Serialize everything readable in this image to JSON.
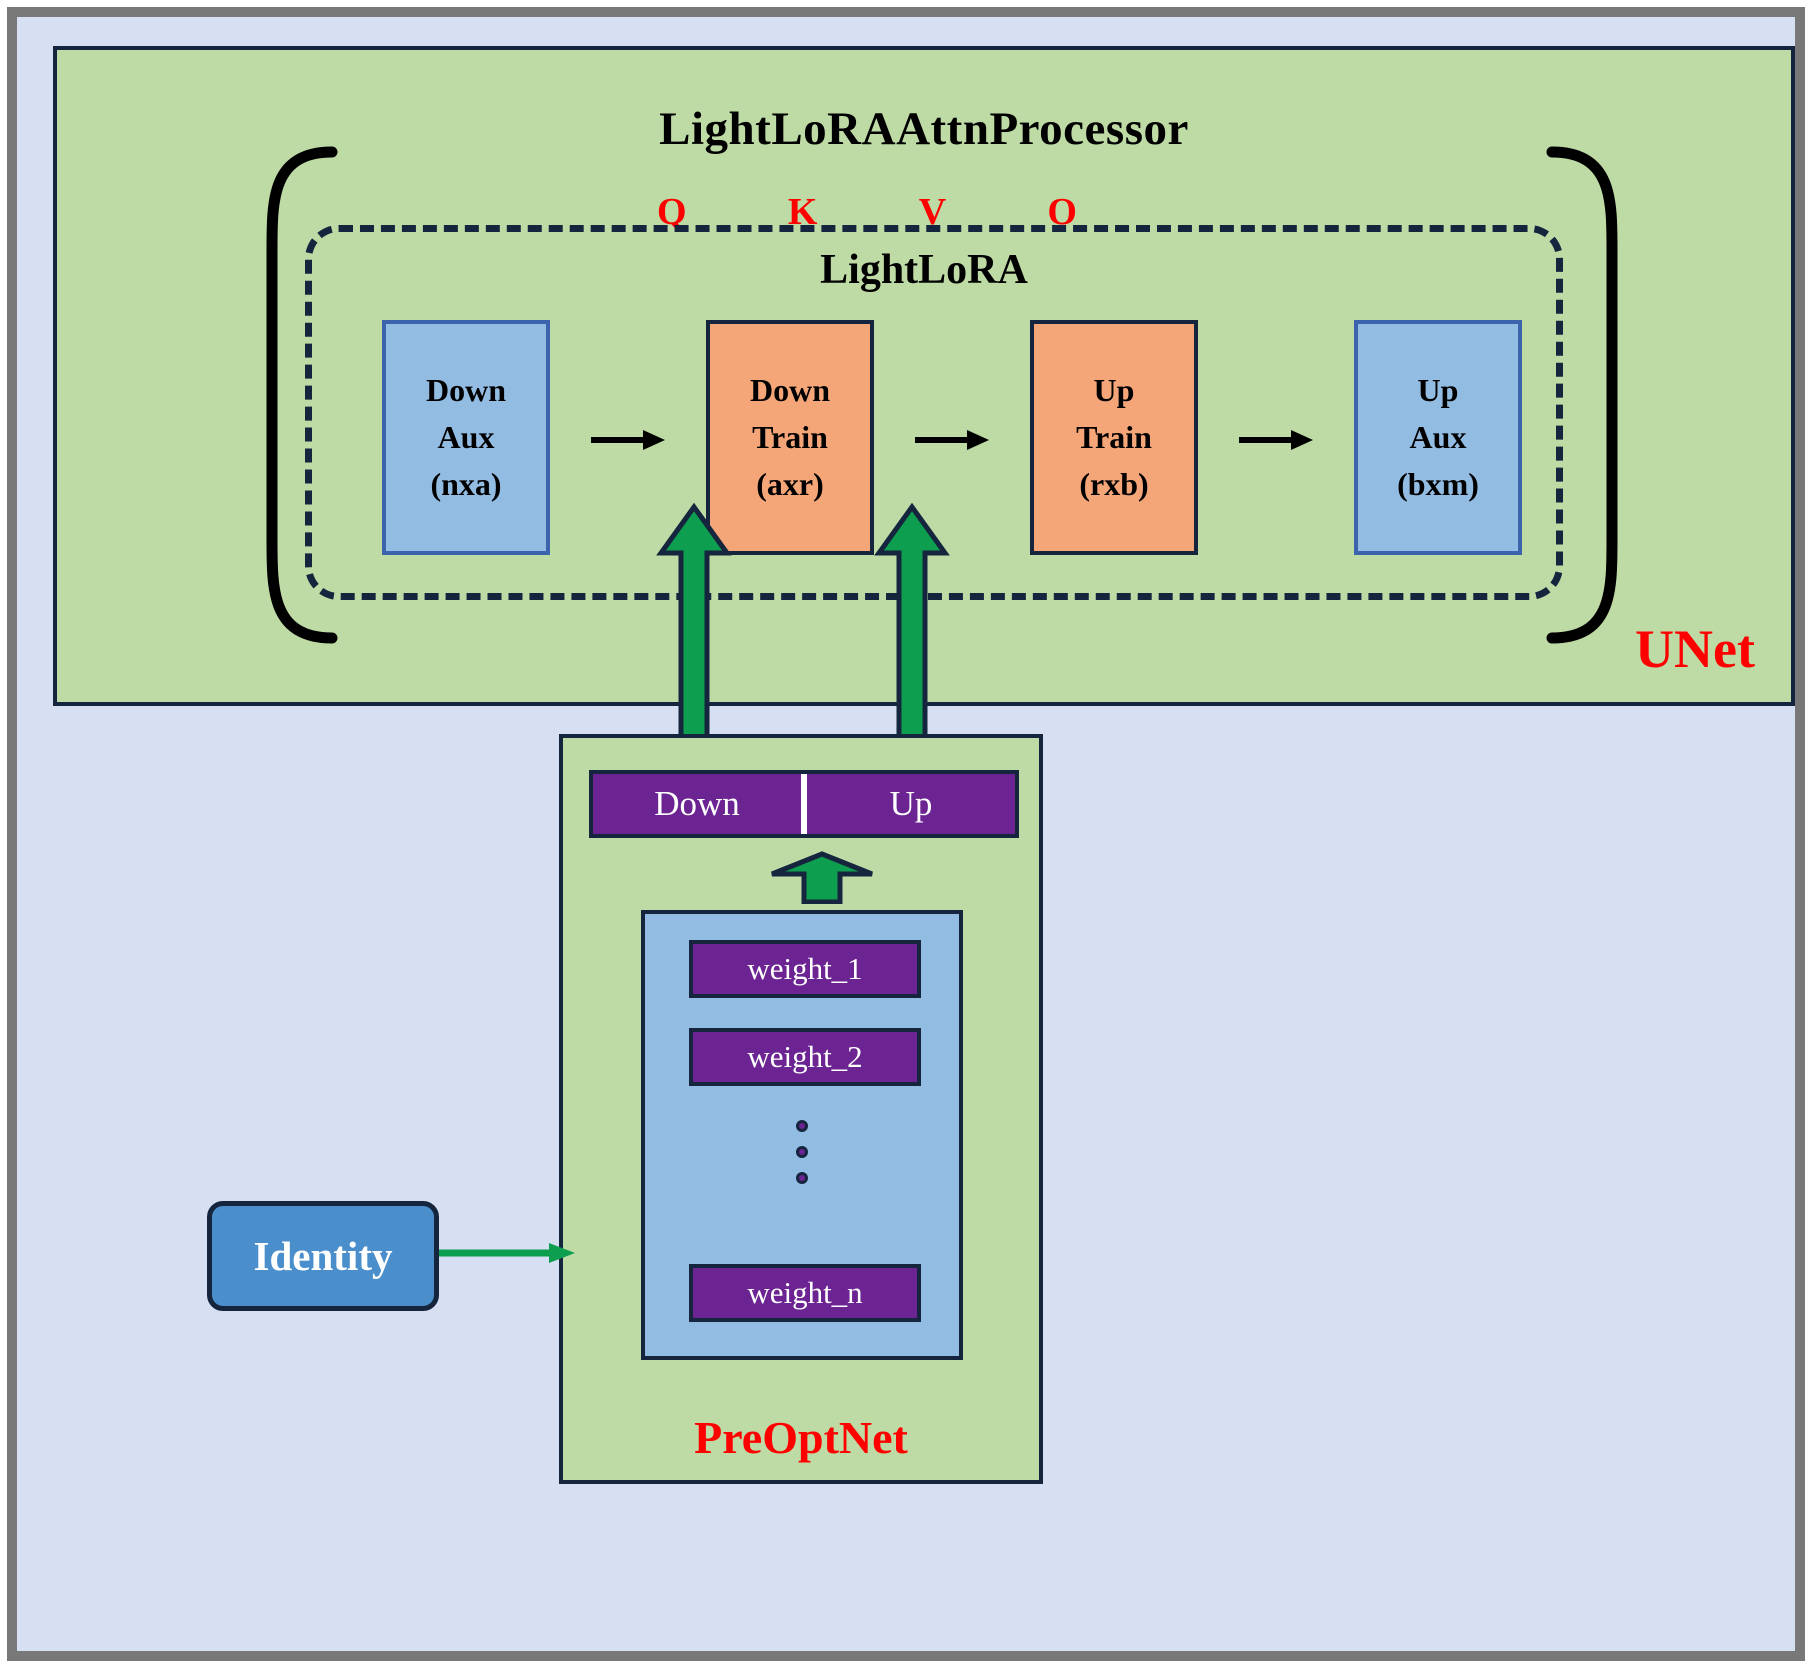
{
  "diagram": {
    "outer": {
      "bg_color": "#d7dff2",
      "frame_color": "#787878"
    },
    "unet": {
      "title": "LightLoRAAttnProcessor",
      "label": "UNet",
      "label_color": "#ff0000",
      "panel_color": "#bfdba5",
      "projections": [
        "Q",
        "K",
        "V",
        "O"
      ],
      "lora": {
        "title": "LightLoRA",
        "blocks": [
          {
            "name": "down-aux",
            "lines": [
              "Down",
              "Aux",
              "(nxa)"
            ],
            "color": "#93bce3",
            "kind": "aux"
          },
          {
            "name": "down-train",
            "lines": [
              "Down",
              "Train",
              "(axr)"
            ],
            "color": "#f5a678",
            "kind": "train"
          },
          {
            "name": "up-train",
            "lines": [
              "Up",
              "Train",
              "(rxb)"
            ],
            "color": "#f5a678",
            "kind": "train"
          },
          {
            "name": "up-aux",
            "lines": [
              "Up",
              "Aux",
              "(bxm)"
            ],
            "color": "#93bce3",
            "kind": "aux"
          }
        ]
      }
    },
    "preoptnet": {
      "label": "PreOptNet",
      "label_color": "#ff0000",
      "panel_color": "#bfdba5",
      "head_bar": {
        "left": "Down",
        "right": "Up",
        "color": "#6b2491"
      },
      "weights": [
        "weight_1",
        "weight_2",
        "weight_n"
      ],
      "ellipsis_dots": 3,
      "holder_color": "#93bce3"
    },
    "identity": {
      "label": "Identity",
      "color": "#4a8fcb"
    },
    "arrow_color": "#0d9e4f"
  }
}
